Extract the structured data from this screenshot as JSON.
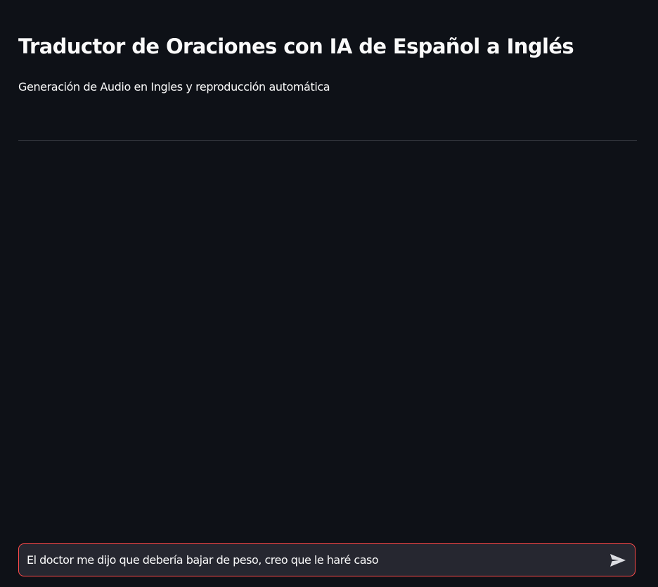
{
  "page": {
    "title": "Traductor de Oraciones con IA de Español a Inglés",
    "subtitle": "Generación de Audio en Ingles y reproducción automática"
  },
  "chat_input": {
    "value": "El doctor me dijo que debería bajar de peso, creo que le haré caso",
    "send_icon": "send-icon"
  },
  "colors": {
    "background": "#0e1117",
    "text": "#fafafa",
    "input_background": "#262730",
    "input_border_focus": "#ff4b4b",
    "divider": "#3a3d45",
    "send_icon": "#dcdde2"
  }
}
